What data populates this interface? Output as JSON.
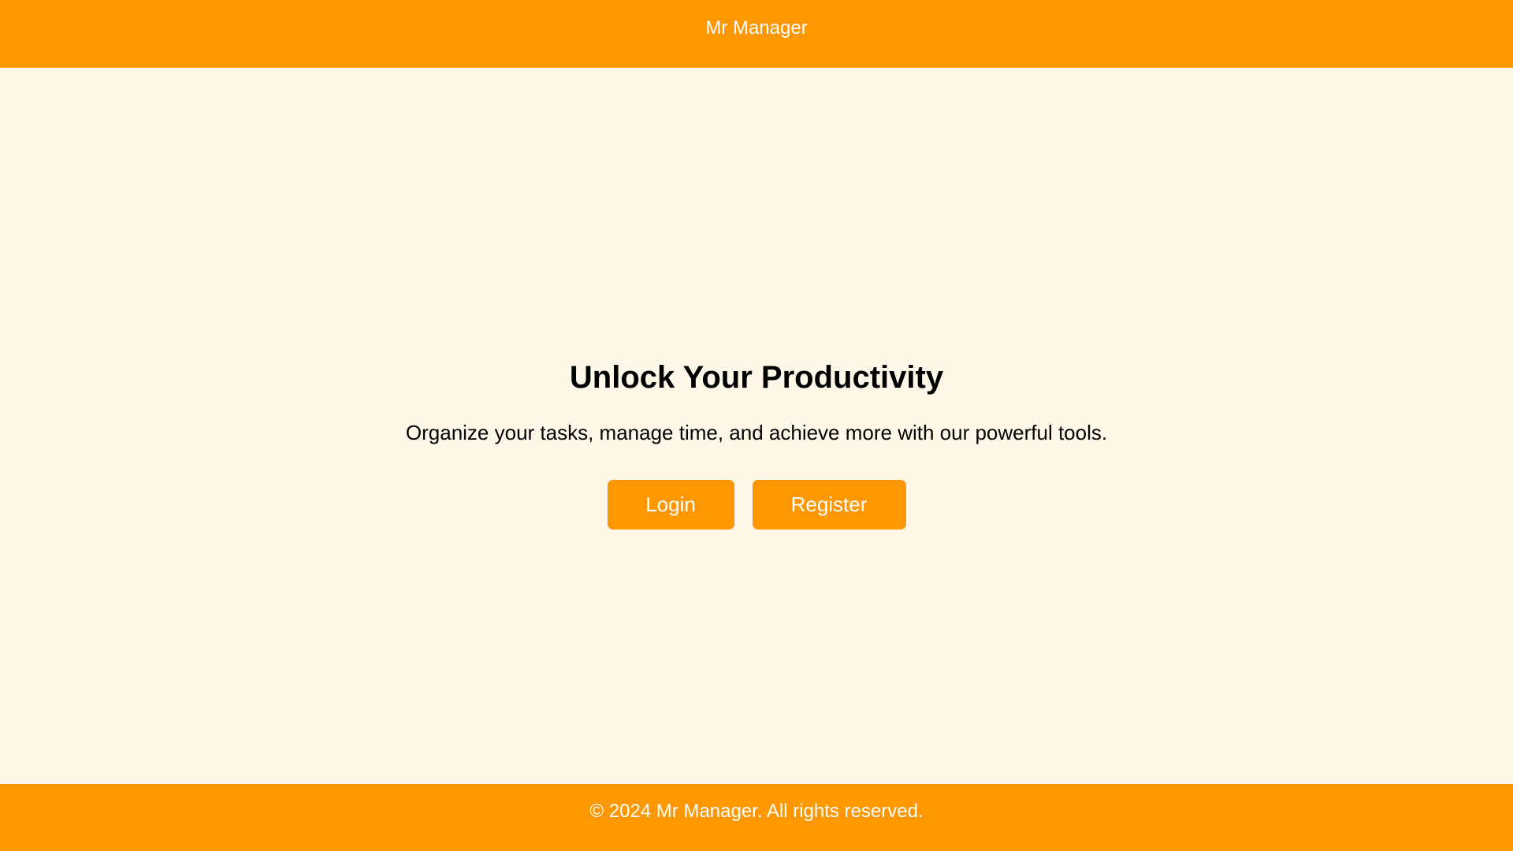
{
  "header": {
    "title": "Mr Manager"
  },
  "hero": {
    "title": "Unlock Your Productivity",
    "subtitle": "Organize your tasks, manage time, and achieve more with our powerful tools.",
    "login_label": "Login",
    "register_label": "Register"
  },
  "footer": {
    "text": "© 2024 Mr Manager. All rights reserved."
  },
  "colors": {
    "brand": "#FF9800",
    "background": "#FFF7E8",
    "text": "#000000",
    "on_brand": "#FFFFFF"
  }
}
